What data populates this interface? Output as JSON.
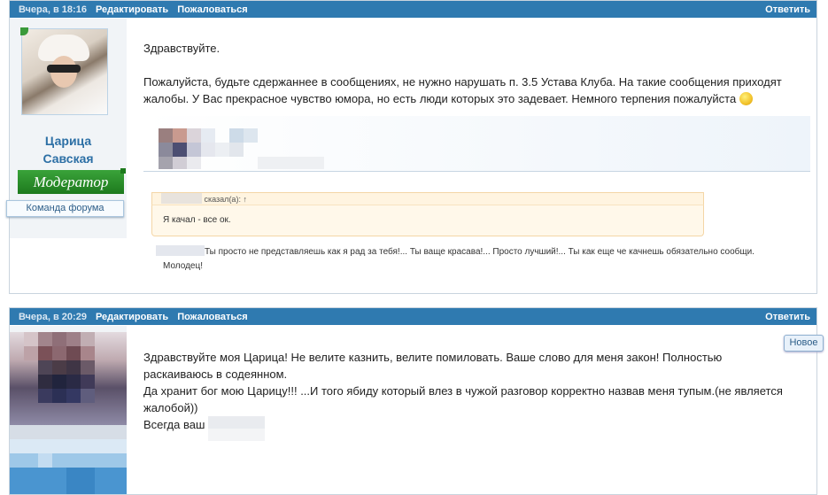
{
  "post1": {
    "date": "Вчера, в 18:16",
    "edit": "Редактировать",
    "report": "Пожаловаться",
    "reply": "Ответить",
    "author_line1": "Царица",
    "author_line2": "Савская",
    "role_badge": "Модератор",
    "team_badge": "Команда форума",
    "greeting": "Здравствуйте.",
    "body_line1": "Пожалуйста, будьте сдержаннее в сообщениях, не нужно нарушать п. 3.5 Устава Клуба. На такие сообщения приходят",
    "body_line2": "жалобы. У Вас прекрасное чувство юмора, но есть люди которых это задевает. Немного терпения пожалуйста",
    "quote_header": "сказал(а): ↑",
    "quote_text": "Я качал - все ок.",
    "reply_line1": "Ты просто не представляешь как я рад за тебя!... Ты ваще красава!... Просто лучший!... Ты как еще че качнешь обязательно сообщи.",
    "reply_line2": "Молодец!"
  },
  "post2": {
    "date": "Вчера, в 20:29",
    "edit": "Редактировать",
    "report": "Пожаловаться",
    "reply": "Ответить",
    "new_badge": "Новое",
    "line1": "Здравствуйте моя Царица! Не велите казнить, велите помиловать. Ваше слово для меня закон! Полностью",
    "line2": "раскаиваюсь в содеянном.",
    "line3": "Да хранит бог мою Царицу!!! ...И того ябиду который влез в чужой разговор корректно назвав меня тупым.(не является",
    "line4": "жалобой))",
    "line5": "Всегда ваш"
  },
  "colors": {
    "header": "#2f7ab0",
    "username": "#2c6fa5",
    "badge_green": "#2a8f2a"
  }
}
